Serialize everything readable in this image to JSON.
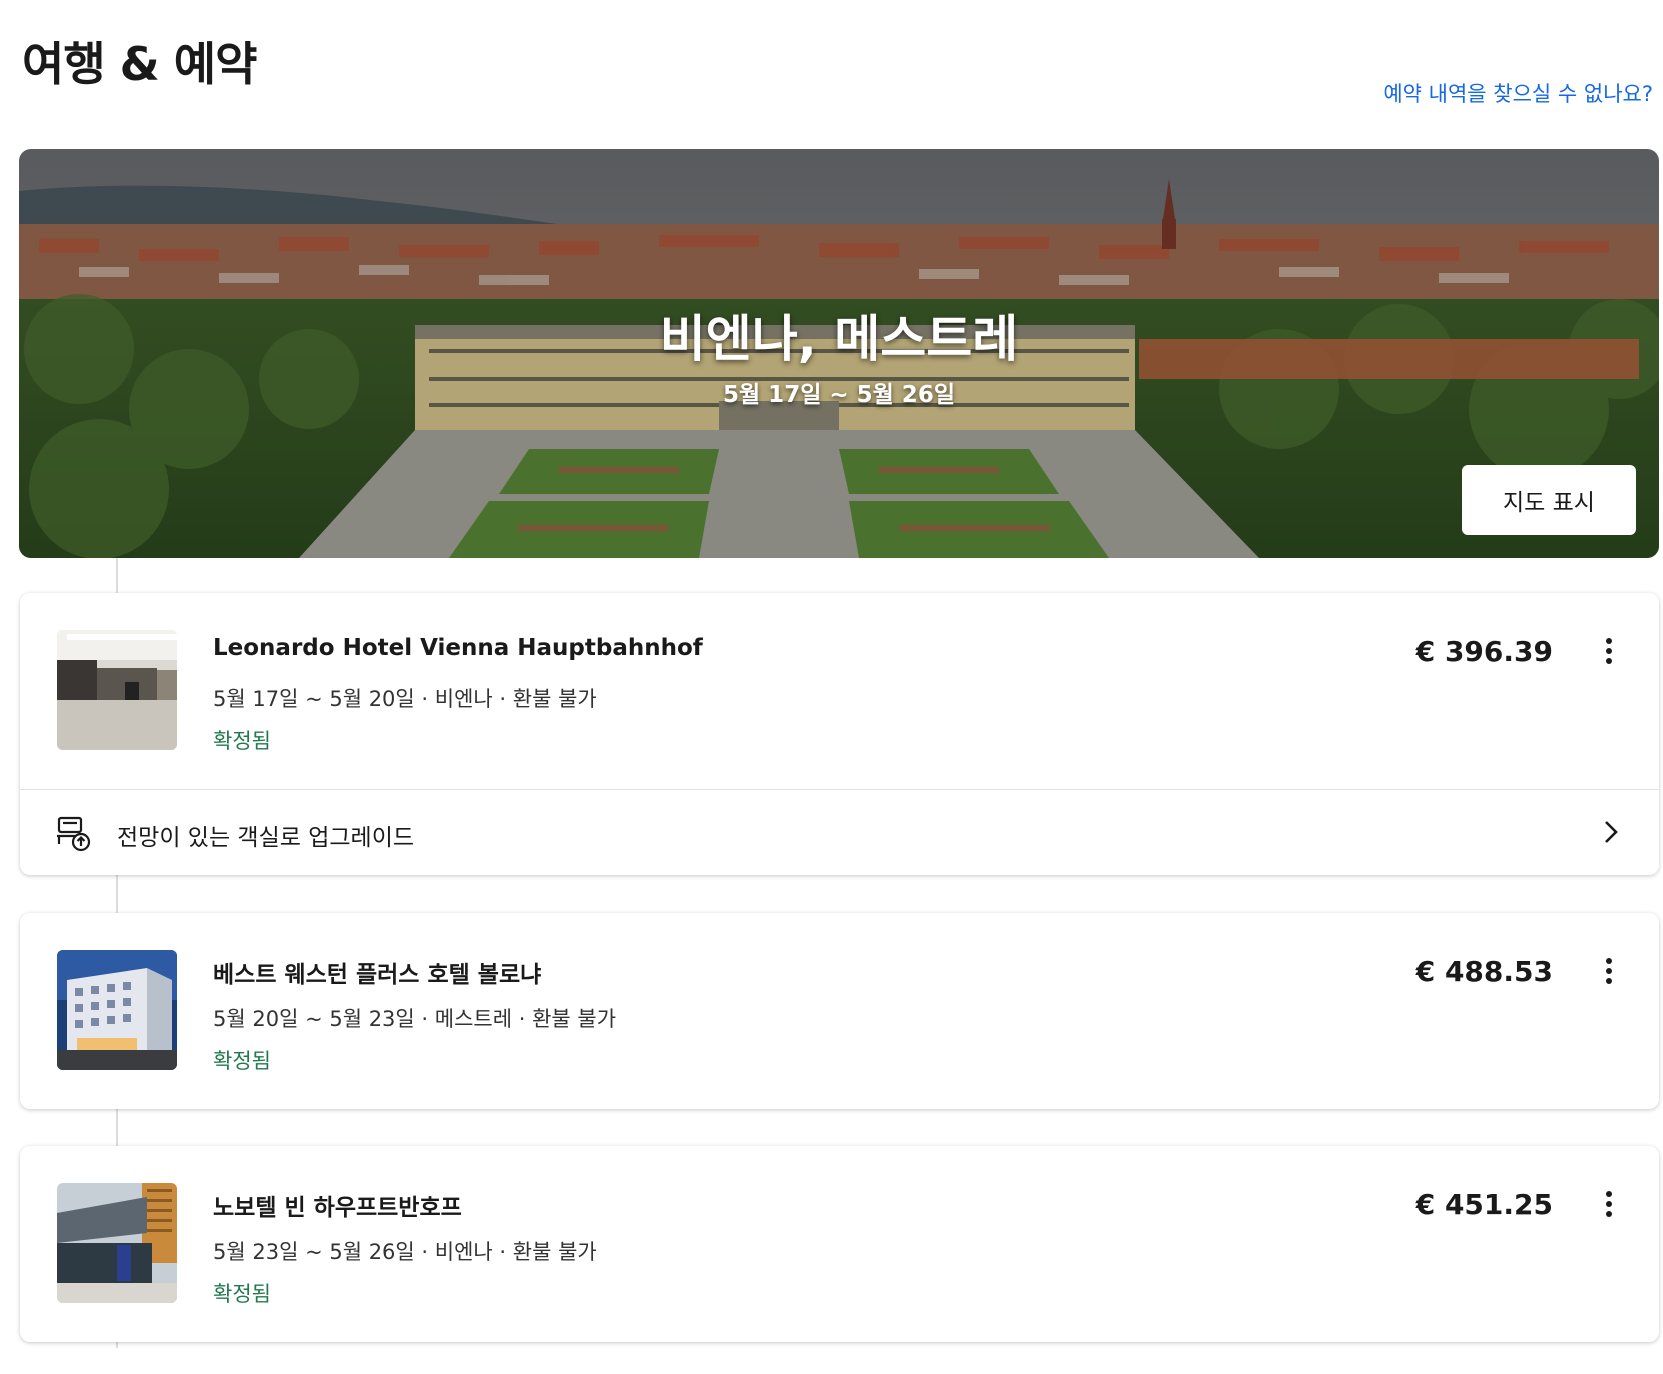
{
  "header": {
    "title": "여행 & 예약",
    "help_link": "예약 내역을 찾으실 수 없나요?"
  },
  "hero": {
    "city": "비엔나, 메스트레",
    "dates": "5월 17일 ~ 5월 26일",
    "map_button": "지도 표시"
  },
  "bookings": [
    {
      "name": "Leonardo Hotel Vienna Hauptbahnhof",
      "meta": "5월 17일 ~ 5월 20일 · 비엔나 · 환불 불가",
      "status": "확정됨",
      "price": "€ 396.39",
      "upgrade_label": "전망이 있는 객실로 업그레이드"
    },
    {
      "name": "베스트 웨스턴 플러스 호텔 볼로냐",
      "meta": "5월 20일 ~ 5월 23일 · 메스트레 · 환불 불가",
      "status": "확정됨",
      "price": "€ 488.53"
    },
    {
      "name": "노보텔 빈 하우프트반호프",
      "meta": "5월 23일 ~ 5월 26일 · 비엔나 · 환불 불가",
      "status": "확정됨",
      "price": "€ 451.25"
    }
  ],
  "colors": {
    "link": "#1668e3",
    "confirmed": "#227950",
    "text": "#1a1a1a"
  },
  "icons": {
    "more": "more-vertical-icon",
    "upgrade": "room-upgrade-icon",
    "chevron": "chevron-right-icon"
  }
}
